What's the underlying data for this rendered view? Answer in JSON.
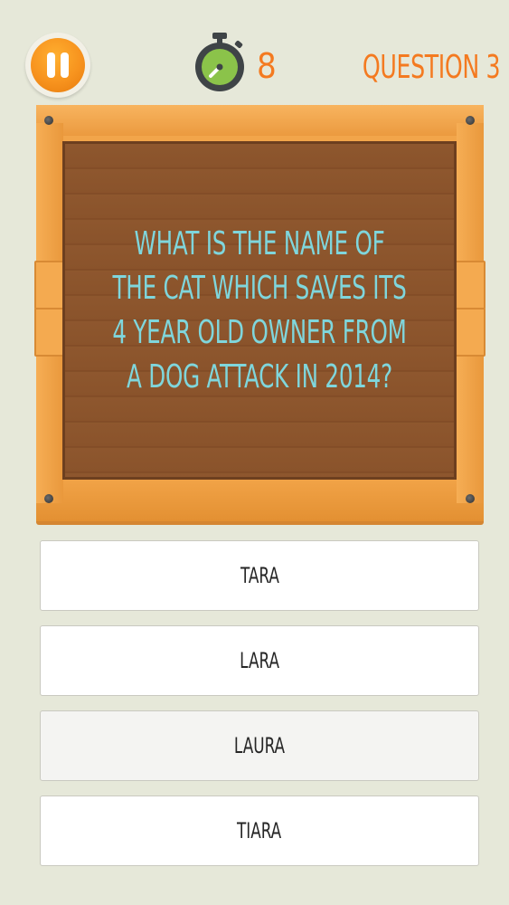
{
  "header": {
    "pause_icon": "pause-icon",
    "timer_icon": "stopwatch-icon",
    "timer_count": "8",
    "question_label": "QUESTION 3"
  },
  "question": {
    "text": "WHAT IS THE NAME OF THE CAT WHICH SAVES ITS 4 YEAR OLD OWNER FROM A DOG ATTACK IN 2014?"
  },
  "answers": [
    {
      "label": "TARA"
    },
    {
      "label": "LARA"
    },
    {
      "label": "LAURA"
    },
    {
      "label": "TIARA"
    }
  ],
  "colors": {
    "background": "#e6e8d9",
    "accent_orange": "#f47a20",
    "question_text": "#7fd6dc",
    "timer_green": "#8bc34a",
    "wood": "#8c552d",
    "frame": "#f2a54a"
  }
}
